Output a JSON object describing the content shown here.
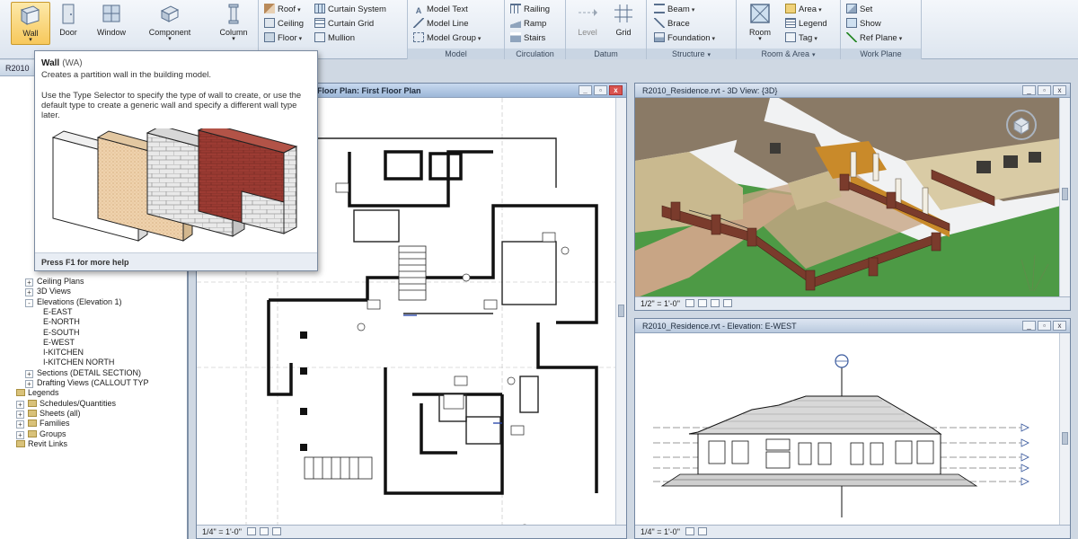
{
  "ribbon": {
    "wall": {
      "label": "Wall"
    },
    "door": {
      "label": "Door"
    },
    "window": {
      "label": "Window"
    },
    "component": {
      "label": "Component"
    },
    "column": {
      "label": "Column"
    },
    "roof": {
      "label": "Roof"
    },
    "ceiling": {
      "label": "Ceiling"
    },
    "floor": {
      "label": "Floor"
    },
    "curtain_system": {
      "label": "Curtain System"
    },
    "curtain_grid": {
      "label": "Curtain Grid"
    },
    "mullion": {
      "label": "Mullion"
    },
    "model_text": {
      "label": "Model Text"
    },
    "model_line": {
      "label": "Model Line"
    },
    "model_group": {
      "label": "Model Group"
    },
    "railing": {
      "label": "Railing"
    },
    "ramp": {
      "label": "Ramp"
    },
    "stairs": {
      "label": "Stairs"
    },
    "level": {
      "label": "Level"
    },
    "grid": {
      "label": "Grid"
    },
    "beam": {
      "label": "Beam"
    },
    "brace": {
      "label": "Brace"
    },
    "foundation": {
      "label": "Foundation"
    },
    "room": {
      "label": "Room"
    },
    "area": {
      "label": "Area"
    },
    "legend": {
      "label": "Legend"
    },
    "tag": {
      "label": "Tag"
    },
    "set": {
      "label": "Set"
    },
    "show": {
      "label": "Show"
    },
    "ref_plane": {
      "label": "Ref Plane"
    },
    "panels": {
      "model": "Model",
      "circulation": "Circulation",
      "datum": "Datum",
      "structure": "Structure",
      "room_area": "Room & Area",
      "work_plane": "Work Plane"
    }
  },
  "tooltip": {
    "title": "Wall",
    "shortcut": "(WA)",
    "description": "Creates a partition wall in the building model.",
    "body": "Use the Type Selector to specify the type of wall to create, or use the default type to create a generic wall and specify a different wall type later.",
    "footer": "Press F1 for more help"
  },
  "browser": {
    "header": "R2010",
    "items": [
      {
        "label": "Ceiling Plans",
        "indent": 1,
        "toggle": "+"
      },
      {
        "label": "3D Views",
        "indent": 1,
        "toggle": "+"
      },
      {
        "label": "Elevations (Elevation 1)",
        "indent": 1,
        "toggle": "-"
      },
      {
        "label": "E-EAST",
        "indent": 3,
        "toggle": ""
      },
      {
        "label": "E-NORTH",
        "indent": 3,
        "toggle": ""
      },
      {
        "label": "E-SOUTH",
        "indent": 3,
        "toggle": ""
      },
      {
        "label": "E-WEST",
        "indent": 3,
        "toggle": ""
      },
      {
        "label": "I-KITCHEN",
        "indent": 3,
        "toggle": ""
      },
      {
        "label": "I-KITCHEN NORTH",
        "indent": 3,
        "toggle": ""
      },
      {
        "label": "Sections (DETAIL SECTION)",
        "indent": 1,
        "toggle": "+"
      },
      {
        "label": "Drafting Views (CALLOUT TYP",
        "indent": 1,
        "toggle": "+"
      },
      {
        "label": "Legends",
        "indent": 0,
        "toggle": ""
      },
      {
        "label": "Schedules/Quantities",
        "indent": 0,
        "toggle": "+"
      },
      {
        "label": "Sheets (all)",
        "indent": 0,
        "toggle": "+"
      },
      {
        "label": "Families",
        "indent": 0,
        "toggle": "+"
      },
      {
        "label": "Groups",
        "indent": 0,
        "toggle": "+"
      },
      {
        "label": "Revit Links",
        "indent": 0,
        "toggle": ""
      }
    ]
  },
  "views": {
    "floor_plan": {
      "title": "Floor Plan: First Floor Plan",
      "scale": "1/4\" = 1'-0\""
    },
    "view_3d": {
      "title": "R2010_Residence.rvt - 3D View: {3D}",
      "scale": "1/2\" = 1'-0\""
    },
    "elevation": {
      "title": "R2010_Residence.rvt - Elevation: E-WEST",
      "scale": "1/4\" = 1'-0\""
    }
  },
  "colors": {
    "accent": "#f7c85c",
    "ribbon_bg": "#dde5ef",
    "roof": "#8a7a66",
    "lawn": "#4d9a45",
    "brick": "#8c3c2e"
  }
}
